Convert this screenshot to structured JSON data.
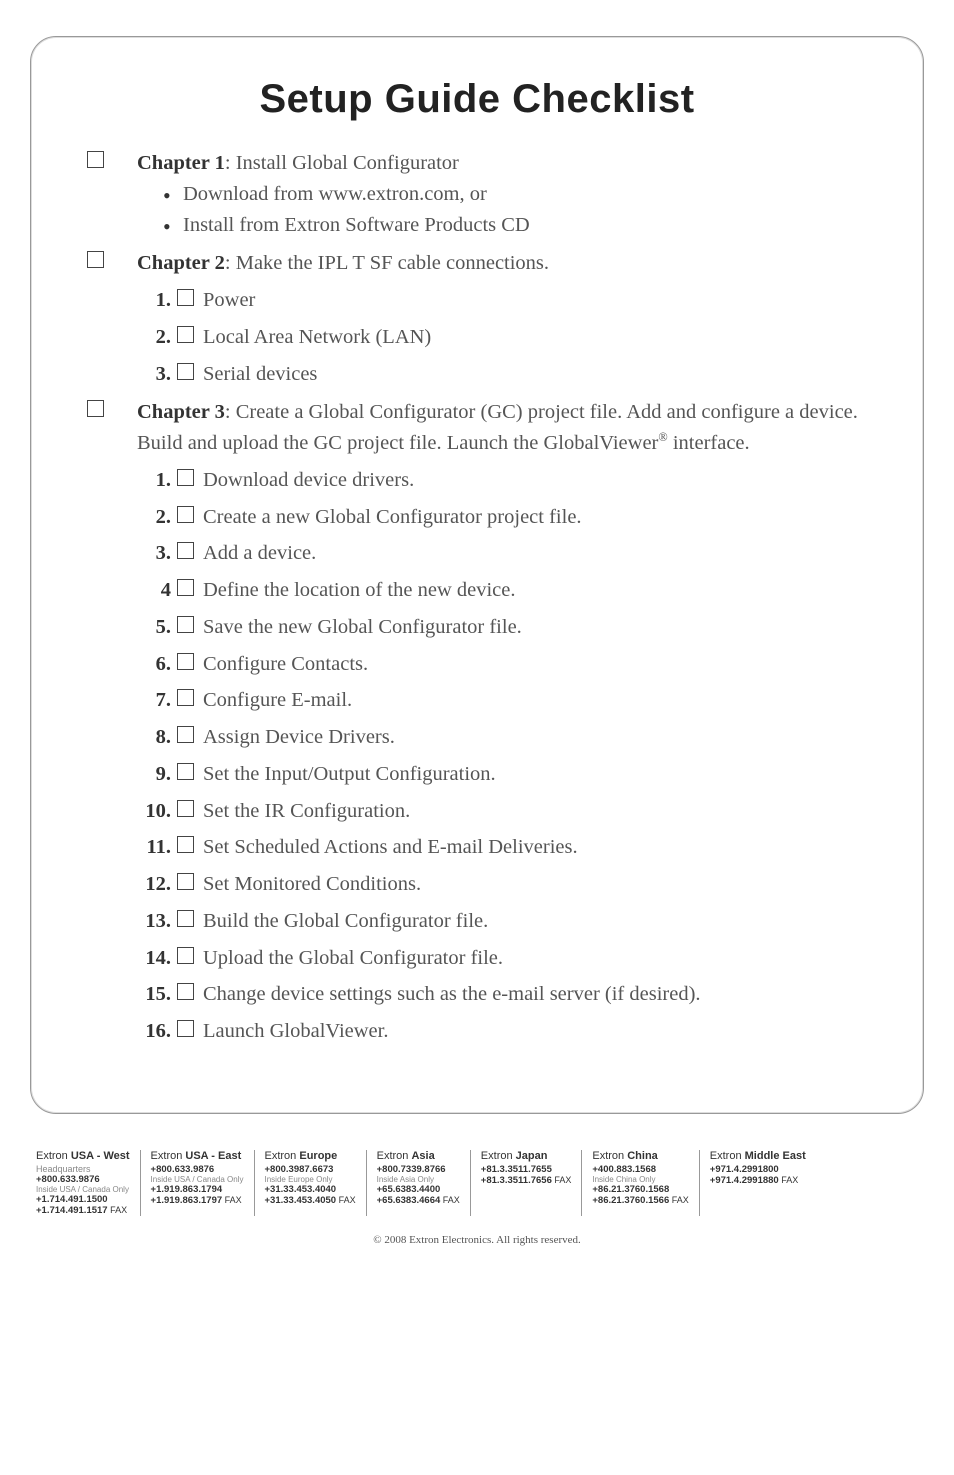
{
  "title": "Setup Guide Checklist",
  "chapters": [
    {
      "heading_pre": "Chapter 1",
      "heading_post": ": Install Global Configurator",
      "bullets": [
        "Download from www.extron.com, or",
        "Install from Extron Software Products CD"
      ]
    },
    {
      "heading_pre": "Chapter 2",
      "heading_post": ": Make the IPL T SF cable connections.",
      "items": [
        {
          "n": "1.",
          "label": "Power"
        },
        {
          "n": "2.",
          "label": "Local Area Network (LAN)"
        },
        {
          "n": "3.",
          "label": "Serial devices"
        }
      ]
    },
    {
      "heading_pre": "Chapter 3",
      "heading_post": ": Create a Global Configurator (GC) project file. Add and configure a device.  Build and upload the GC project file.  Launch the GlobalViewer",
      "heading_sup": "®",
      "heading_tail": " interface.",
      "items": [
        {
          "n": "1.",
          "label": "Download device drivers."
        },
        {
          "n": "2.",
          "label": "Create a new Global Configurator project file."
        },
        {
          "n": "3.",
          "label": "Add a device."
        },
        {
          "n": "4",
          "label": "Define the location of the new device."
        },
        {
          "n": "5.",
          "label": "Save the new Global Configurator file."
        },
        {
          "n": "6.",
          "label": "Configure Contacts."
        },
        {
          "n": "7.",
          "label": "Configure E-mail."
        },
        {
          "n": "8.",
          "label": "Assign Device Drivers."
        },
        {
          "n": "9.",
          "label": "Set the Input/Output Configuration."
        },
        {
          "n": "10.",
          "label": "Set the IR Configuration."
        },
        {
          "n": "11.",
          "label": "Set Scheduled Actions and E-mail Deliveries."
        },
        {
          "n": "12.",
          "label": "Set Monitored Conditions."
        },
        {
          "n": "13.",
          "label": "Build the Global Configurator file."
        },
        {
          "n": "14.",
          "label": "Upload the Global Configurator file."
        },
        {
          "n": "15.",
          "label": "Change device settings such as the e-mail server (if desired)."
        },
        {
          "n": "16.",
          "label": "Launch GlobalViewer."
        }
      ]
    }
  ],
  "footer": {
    "cols": [
      {
        "region_pre": "Extron ",
        "region_bold": "USA - West",
        "sub": "Headquarters",
        "lines": [
          {
            "ph": "+800.633.9876",
            "note": "Inside USA / Canada Only"
          },
          {
            "ph": "+1.714.491.1500"
          },
          {
            "ph": "+1.714.491.1517",
            "suf": " FAX"
          }
        ]
      },
      {
        "region_pre": "Extron ",
        "region_bold": "USA - East",
        "lines": [
          {
            "ph": "+800.633.9876",
            "note": "Inside USA / Canada Only"
          },
          {
            "ph": "+1.919.863.1794"
          },
          {
            "ph": "+1.919.863.1797",
            "suf": " FAX"
          }
        ]
      },
      {
        "region_pre": "Extron ",
        "region_bold": "Europe",
        "lines": [
          {
            "ph": "+800.3987.6673",
            "note": "Inside Europe Only"
          },
          {
            "ph": "+31.33.453.4040"
          },
          {
            "ph": "+31.33.453.4050",
            "suf": " FAX"
          }
        ]
      },
      {
        "region_pre": "Extron ",
        "region_bold": "Asia",
        "lines": [
          {
            "ph": "+800.7339.8766",
            "note": "Inside Asia Only"
          },
          {
            "ph": "+65.6383.4400"
          },
          {
            "ph": "+65.6383.4664",
            "suf": " FAX"
          }
        ]
      },
      {
        "region_pre": "Extron ",
        "region_bold": "Japan",
        "lines": [
          {
            "ph": "+81.3.3511.7655"
          },
          {
            "ph": "+81.3.3511.7656",
            "suf": " FAX"
          }
        ]
      },
      {
        "region_pre": "Extron ",
        "region_bold": "China",
        "lines": [
          {
            "ph": "+400.883.1568",
            "note": "Inside China Only"
          },
          {
            "ph": "+86.21.3760.1568"
          },
          {
            "ph": "+86.21.3760.1566",
            "suf": " FAX"
          }
        ]
      },
      {
        "region_pre": "Extron ",
        "region_bold": "Middle East",
        "lines": [
          {
            "ph": "+971.4.2991800"
          },
          {
            "ph": "+971.4.2991880",
            "suf": " FAX"
          }
        ]
      }
    ],
    "copyright": "© 2008  Extron Electronics.  All rights reserved."
  }
}
